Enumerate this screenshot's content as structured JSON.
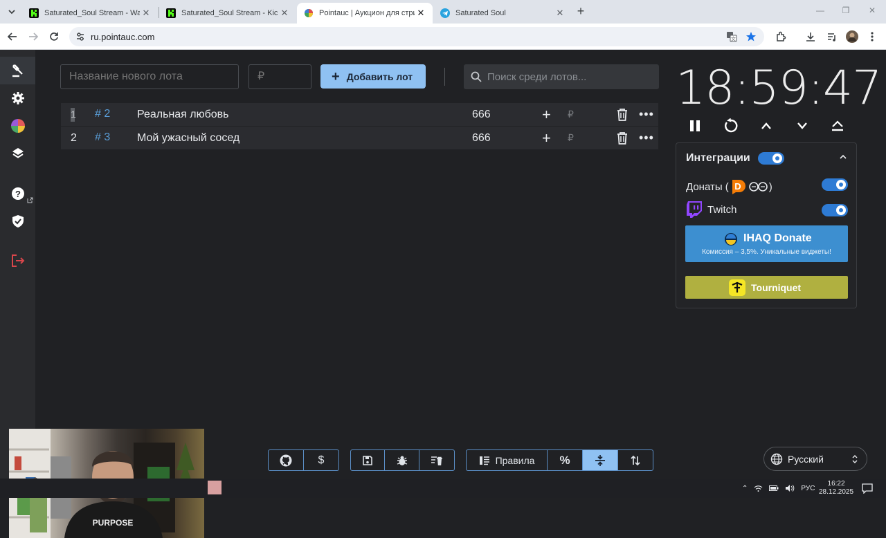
{
  "browser": {
    "tabs": [
      {
        "label": "Saturated_Soul Stream - Watch",
        "icon": "kick-icon"
      },
      {
        "label": "Saturated_Soul Stream - Kick D",
        "icon": "kick-icon"
      },
      {
        "label": "Pointauc | Аукцион для стриме",
        "icon": "pointauc-icon",
        "active": true
      },
      {
        "label": "Saturated Soul",
        "icon": "telegram-icon"
      }
    ],
    "url": "ru.pointauc.com"
  },
  "toolbar": {
    "new_lot_placeholder": "Название нового лота",
    "amount_placeholder": "₽",
    "add_button_label": "Добавить лот",
    "search_placeholder": "Поиск среди лотов..."
  },
  "lots": [
    {
      "index": "1",
      "id": "# 2",
      "name": "Реальная любовь",
      "amount": "666",
      "currency": "₽"
    },
    {
      "index": "2",
      "id": "# 3",
      "name": "Мой ужасный сосед",
      "amount": "666",
      "currency": "₽"
    }
  ],
  "timer": {
    "display": "18:59:47"
  },
  "integrations": {
    "title": "Интеграции",
    "enabled": true,
    "donations_label_prefix": "Донаты (",
    "donations_label_suffix": ")",
    "donations_enabled": true,
    "twitch_label": "Twitch",
    "twitch_enabled": true,
    "ihaq_title": "IHAQ Donate",
    "ihaq_subtitle": "Комиссия – 3,5%. Уникальные виджеты!",
    "tourniquet_label": "Tourniquet"
  },
  "bottom_bar": {
    "rules_label": "Правила",
    "percent_label": "%",
    "dollar_label": "$"
  },
  "language": {
    "selected": "Русский"
  },
  "taskbar": {
    "lang": "РУС",
    "time": "16:22",
    "date": "28.12.2025"
  },
  "colors": {
    "accent": "#8fc1f2",
    "toggle": "#2e7bd4",
    "background": "#202124",
    "ihaq": "#3d8fd0",
    "tourniquet": "#b0b040"
  }
}
